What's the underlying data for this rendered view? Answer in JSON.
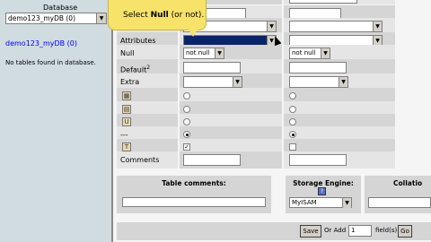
{
  "sidebar": {
    "database_label": "Database",
    "database_select": "demo123_myDB (0)",
    "database_link": "demo123_myDB (0)",
    "no_tables": "No tables found in database."
  },
  "tooltip": {
    "prefix": "Select ",
    "bold": "Null",
    "suffix": " (or not)."
  },
  "rows": {
    "attributes": "Attributes",
    "null": "Null",
    "null_value": "not null",
    "default": "Default",
    "default_sup": "2",
    "extra": "Extra",
    "dash": "---",
    "comments": "Comments"
  },
  "table_comments": {
    "header": "Table comments:"
  },
  "storage": {
    "header": "Storage Engine:",
    "help": "?",
    "value": "MyISAM"
  },
  "collation": {
    "header": "Collatio"
  },
  "actions": {
    "save": "Save",
    "or_add": "Or Add",
    "count": "1",
    "fields": "field(s)",
    "go": "Go"
  }
}
